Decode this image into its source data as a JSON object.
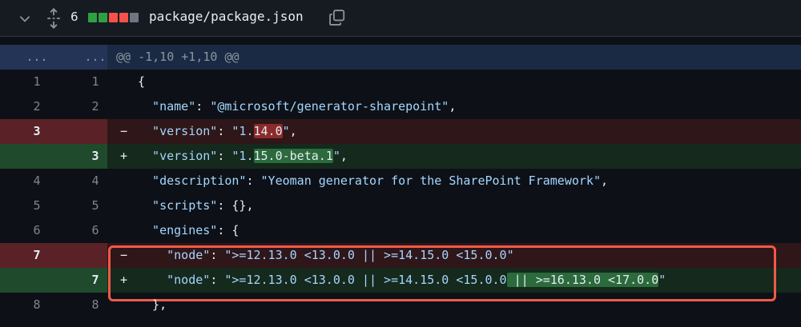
{
  "header": {
    "count": "6",
    "filename": "package/package.json",
    "stat_colors": [
      "#2ea043",
      "#2ea043",
      "#f85149",
      "#f85149",
      "#6e7681"
    ]
  },
  "hunk": {
    "ln1": "...",
    "ln2": "...",
    "text": "@@ -1,10 +1,10 @@"
  },
  "rows": [
    {
      "type": "ctx",
      "ln1": "1",
      "ln2": "1",
      "sign": "",
      "parts": [
        {
          "t": "pun",
          "v": "{"
        }
      ]
    },
    {
      "type": "ctx",
      "ln1": "2",
      "ln2": "2",
      "sign": "",
      "parts": [
        {
          "t": "key",
          "v": "  \"name\""
        },
        {
          "t": "pun",
          "v": ": "
        },
        {
          "t": "str",
          "v": "\"@microsoft/generator-sharepoint\""
        },
        {
          "t": "pun",
          "v": ","
        }
      ]
    },
    {
      "type": "del",
      "ln1": "3",
      "ln2": "",
      "sign": "−",
      "parts": [
        {
          "t": "key",
          "v": "  \"version\""
        },
        {
          "t": "pun",
          "v": ": "
        },
        {
          "t": "str",
          "v": "\"1."
        },
        {
          "t": "hl-del",
          "v": "14.0"
        },
        {
          "t": "str",
          "v": "\""
        },
        {
          "t": "pun",
          "v": ","
        }
      ]
    },
    {
      "type": "add",
      "ln1": "",
      "ln2": "3",
      "sign": "+",
      "parts": [
        {
          "t": "key",
          "v": "  \"version\""
        },
        {
          "t": "pun",
          "v": ": "
        },
        {
          "t": "str",
          "v": "\"1."
        },
        {
          "t": "hl-add",
          "v": "15.0-beta.1"
        },
        {
          "t": "str",
          "v": "\""
        },
        {
          "t": "pun",
          "v": ","
        }
      ]
    },
    {
      "type": "ctx",
      "ln1": "4",
      "ln2": "4",
      "sign": "",
      "parts": [
        {
          "t": "key",
          "v": "  \"description\""
        },
        {
          "t": "pun",
          "v": ": "
        },
        {
          "t": "str",
          "v": "\"Yeoman generator for the SharePoint Framework\""
        },
        {
          "t": "pun",
          "v": ","
        }
      ]
    },
    {
      "type": "ctx",
      "ln1": "5",
      "ln2": "5",
      "sign": "",
      "parts": [
        {
          "t": "key",
          "v": "  \"scripts\""
        },
        {
          "t": "pun",
          "v": ": {},"
        }
      ]
    },
    {
      "type": "ctx",
      "ln1": "6",
      "ln2": "6",
      "sign": "",
      "parts": [
        {
          "t": "key",
          "v": "  \"engines\""
        },
        {
          "t": "pun",
          "v": ": {"
        }
      ]
    },
    {
      "type": "del",
      "ln1": "7",
      "ln2": "",
      "sign": "−",
      "parts": [
        {
          "t": "key",
          "v": "    \"node\""
        },
        {
          "t": "pun",
          "v": ": "
        },
        {
          "t": "str",
          "v": "\">=12.13.0 <13.0.0 || >=14.15.0 <15.0.0\""
        }
      ]
    },
    {
      "type": "add",
      "ln1": "",
      "ln2": "7",
      "sign": "+",
      "parts": [
        {
          "t": "key",
          "v": "    \"node\""
        },
        {
          "t": "pun",
          "v": ": "
        },
        {
          "t": "str",
          "v": "\">=12.13.0 <13.0.0 || >=14.15.0 <15.0.0"
        },
        {
          "t": "hl-add",
          "v": " || >=16.13.0 <17.0.0"
        },
        {
          "t": "str",
          "v": "\""
        }
      ]
    },
    {
      "type": "ctx",
      "ln1": "8",
      "ln2": "8",
      "sign": "",
      "parts": [
        {
          "t": "pun",
          "v": "  },"
        }
      ]
    }
  ]
}
